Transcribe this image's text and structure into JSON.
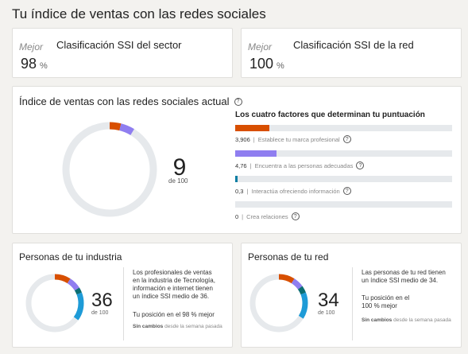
{
  "page": {
    "title": "Tu índice de ventas con las redes sociales"
  },
  "rank_sector": {
    "tag": "Mejor",
    "value": "98",
    "unit": "%",
    "label": "Clasificación SSI del sector"
  },
  "rank_network": {
    "tag": "Mejor",
    "value": "100",
    "unit": "%",
    "label": "Clasificación SSI de la red"
  },
  "main": {
    "title": "Índice de ventas con las redes sociales actual",
    "score": "9",
    "score_sub": "de 100",
    "factors_title": "Los cuatro factores que determinan tu puntuación",
    "factors": [
      {
        "value": "3,906",
        "label": "Establece tu marca profesional",
        "color": "#d84f00",
        "fraction": 0.156
      },
      {
        "value": "4,76",
        "label": "Encuentra a las personas adecuadas",
        "color": "#8f7ef0",
        "fraction": 0.19
      },
      {
        "value": "0,3",
        "label": "Interactúa ofreciendo información",
        "color": "#0a7ea3",
        "fraction": 0.012
      },
      {
        "value": "0",
        "label": "Crea relaciones",
        "color": "#0b8f72",
        "fraction": 0
      }
    ]
  },
  "industry": {
    "title": "Personas de tu industria",
    "score": "36",
    "score_sub": "de 100",
    "desc": [
      "Los profesionales de ventas",
      "en la industria de Tecnología,",
      "información e internet tienen",
      "un índice SSI medio de 36."
    ],
    "position": [
      "Tu posición en el 98 % mejor"
    ],
    "change_bold": "Sin cambios",
    "change_rest": "desde la semana pasada",
    "segments": [
      {
        "color": "#d84f00",
        "fraction": 0.09
      },
      {
        "color": "#8f7ef0",
        "fraction": 0.07
      },
      {
        "color": "#0b6e73",
        "fraction": 0.03
      },
      {
        "color": "#1e9bd7",
        "fraction": 0.16
      }
    ]
  },
  "network": {
    "title": "Personas de tu red",
    "score": "34",
    "score_sub": "de 100",
    "desc": [
      "Las personas de tu red tienen",
      "un índice SSI medio de 34."
    ],
    "position": [
      "Tu posición en el",
      "100 % mejor"
    ],
    "change_bold": "Sin cambios",
    "change_rest": "desde la semana pasada",
    "segments": [
      {
        "color": "#d84f00",
        "fraction": 0.09
      },
      {
        "color": "#8f7ef0",
        "fraction": 0.06
      },
      {
        "color": "#0b6e73",
        "fraction": 0.04
      },
      {
        "color": "#1e9bd7",
        "fraction": 0.15
      }
    ]
  }
}
